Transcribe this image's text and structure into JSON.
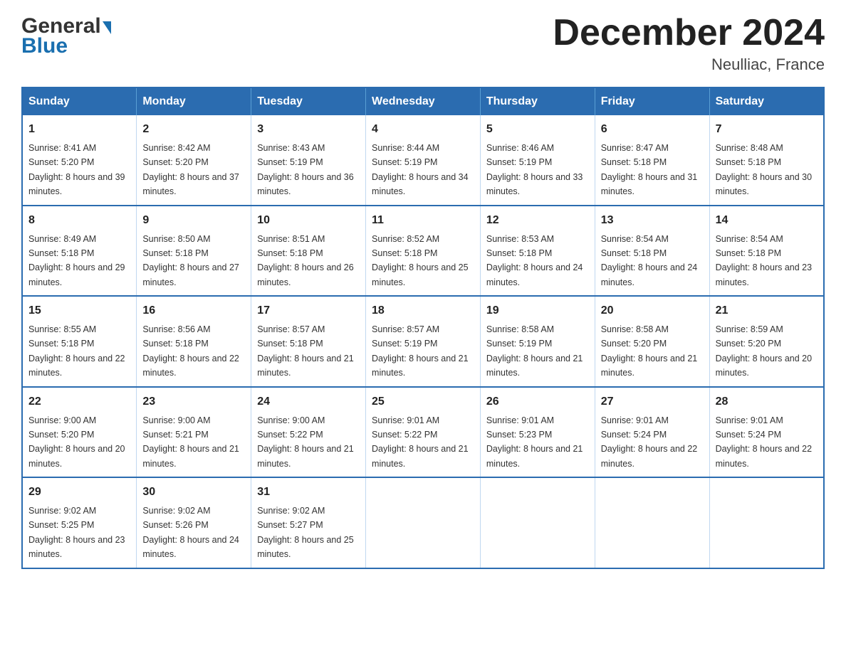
{
  "header": {
    "logo_general": "General",
    "logo_blue": "Blue",
    "month_title": "December 2024",
    "location": "Neulliac, France"
  },
  "days_of_week": [
    "Sunday",
    "Monday",
    "Tuesday",
    "Wednesday",
    "Thursday",
    "Friday",
    "Saturday"
  ],
  "weeks": [
    [
      {
        "day": "1",
        "sunrise": "8:41 AM",
        "sunset": "5:20 PM",
        "daylight": "8 hours and 39 minutes."
      },
      {
        "day": "2",
        "sunrise": "8:42 AM",
        "sunset": "5:20 PM",
        "daylight": "8 hours and 37 minutes."
      },
      {
        "day": "3",
        "sunrise": "8:43 AM",
        "sunset": "5:19 PM",
        "daylight": "8 hours and 36 minutes."
      },
      {
        "day": "4",
        "sunrise": "8:44 AM",
        "sunset": "5:19 PM",
        "daylight": "8 hours and 34 minutes."
      },
      {
        "day": "5",
        "sunrise": "8:46 AM",
        "sunset": "5:19 PM",
        "daylight": "8 hours and 33 minutes."
      },
      {
        "day": "6",
        "sunrise": "8:47 AM",
        "sunset": "5:18 PM",
        "daylight": "8 hours and 31 minutes."
      },
      {
        "day": "7",
        "sunrise": "8:48 AM",
        "sunset": "5:18 PM",
        "daylight": "8 hours and 30 minutes."
      }
    ],
    [
      {
        "day": "8",
        "sunrise": "8:49 AM",
        "sunset": "5:18 PM",
        "daylight": "8 hours and 29 minutes."
      },
      {
        "day": "9",
        "sunrise": "8:50 AM",
        "sunset": "5:18 PM",
        "daylight": "8 hours and 27 minutes."
      },
      {
        "day": "10",
        "sunrise": "8:51 AM",
        "sunset": "5:18 PM",
        "daylight": "8 hours and 26 minutes."
      },
      {
        "day": "11",
        "sunrise": "8:52 AM",
        "sunset": "5:18 PM",
        "daylight": "8 hours and 25 minutes."
      },
      {
        "day": "12",
        "sunrise": "8:53 AM",
        "sunset": "5:18 PM",
        "daylight": "8 hours and 24 minutes."
      },
      {
        "day": "13",
        "sunrise": "8:54 AM",
        "sunset": "5:18 PM",
        "daylight": "8 hours and 24 minutes."
      },
      {
        "day": "14",
        "sunrise": "8:54 AM",
        "sunset": "5:18 PM",
        "daylight": "8 hours and 23 minutes."
      }
    ],
    [
      {
        "day": "15",
        "sunrise": "8:55 AM",
        "sunset": "5:18 PM",
        "daylight": "8 hours and 22 minutes."
      },
      {
        "day": "16",
        "sunrise": "8:56 AM",
        "sunset": "5:18 PM",
        "daylight": "8 hours and 22 minutes."
      },
      {
        "day": "17",
        "sunrise": "8:57 AM",
        "sunset": "5:18 PM",
        "daylight": "8 hours and 21 minutes."
      },
      {
        "day": "18",
        "sunrise": "8:57 AM",
        "sunset": "5:19 PM",
        "daylight": "8 hours and 21 minutes."
      },
      {
        "day": "19",
        "sunrise": "8:58 AM",
        "sunset": "5:19 PM",
        "daylight": "8 hours and 21 minutes."
      },
      {
        "day": "20",
        "sunrise": "8:58 AM",
        "sunset": "5:20 PM",
        "daylight": "8 hours and 21 minutes."
      },
      {
        "day": "21",
        "sunrise": "8:59 AM",
        "sunset": "5:20 PM",
        "daylight": "8 hours and 20 minutes."
      }
    ],
    [
      {
        "day": "22",
        "sunrise": "9:00 AM",
        "sunset": "5:20 PM",
        "daylight": "8 hours and 20 minutes."
      },
      {
        "day": "23",
        "sunrise": "9:00 AM",
        "sunset": "5:21 PM",
        "daylight": "8 hours and 21 minutes."
      },
      {
        "day": "24",
        "sunrise": "9:00 AM",
        "sunset": "5:22 PM",
        "daylight": "8 hours and 21 minutes."
      },
      {
        "day": "25",
        "sunrise": "9:01 AM",
        "sunset": "5:22 PM",
        "daylight": "8 hours and 21 minutes."
      },
      {
        "day": "26",
        "sunrise": "9:01 AM",
        "sunset": "5:23 PM",
        "daylight": "8 hours and 21 minutes."
      },
      {
        "day": "27",
        "sunrise": "9:01 AM",
        "sunset": "5:24 PM",
        "daylight": "8 hours and 22 minutes."
      },
      {
        "day": "28",
        "sunrise": "9:01 AM",
        "sunset": "5:24 PM",
        "daylight": "8 hours and 22 minutes."
      }
    ],
    [
      {
        "day": "29",
        "sunrise": "9:02 AM",
        "sunset": "5:25 PM",
        "daylight": "8 hours and 23 minutes."
      },
      {
        "day": "30",
        "sunrise": "9:02 AM",
        "sunset": "5:26 PM",
        "daylight": "8 hours and 24 minutes."
      },
      {
        "day": "31",
        "sunrise": "9:02 AM",
        "sunset": "5:27 PM",
        "daylight": "8 hours and 25 minutes."
      },
      null,
      null,
      null,
      null
    ]
  ],
  "labels": {
    "sunrise": "Sunrise:",
    "sunset": "Sunset:",
    "daylight": "Daylight:"
  }
}
